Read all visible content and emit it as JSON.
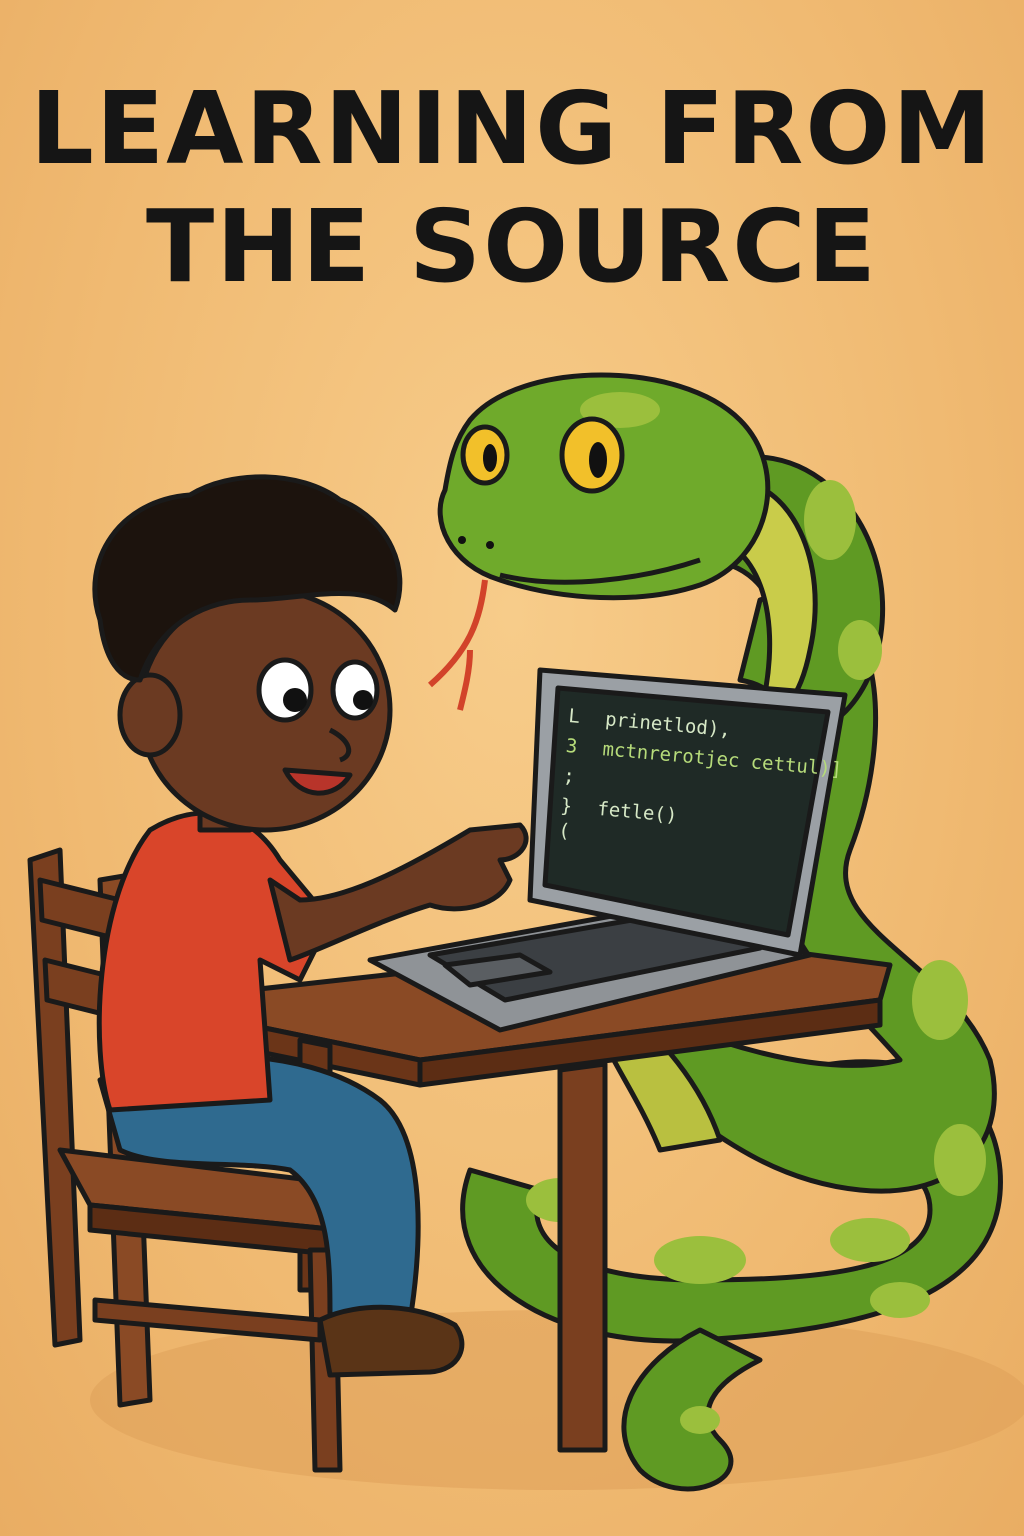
{
  "title": {
    "line1": "LEARNING FROM",
    "line2": "THE SOURCE"
  },
  "screen": {
    "lines": [
      {
        "gutter": "L",
        "code": "prinetlod),"
      },
      {
        "gutter": "3",
        "code": "mctnrerotjec cettul)]"
      },
      {
        "gutter": ";",
        "code": ""
      },
      {
        "gutter": "}",
        "code": "fetle()"
      },
      {
        "gutter": "(",
        "code": ""
      }
    ]
  },
  "colors": {
    "background": "#f0ba72",
    "snake": "#5f9a23",
    "snake_spots": "#8eb53a",
    "shirt": "#d9452a",
    "jeans": "#2f6a8f",
    "wood": "#7a3f1f",
    "screen": "#1f2a26",
    "code": "#d6e8c6"
  }
}
